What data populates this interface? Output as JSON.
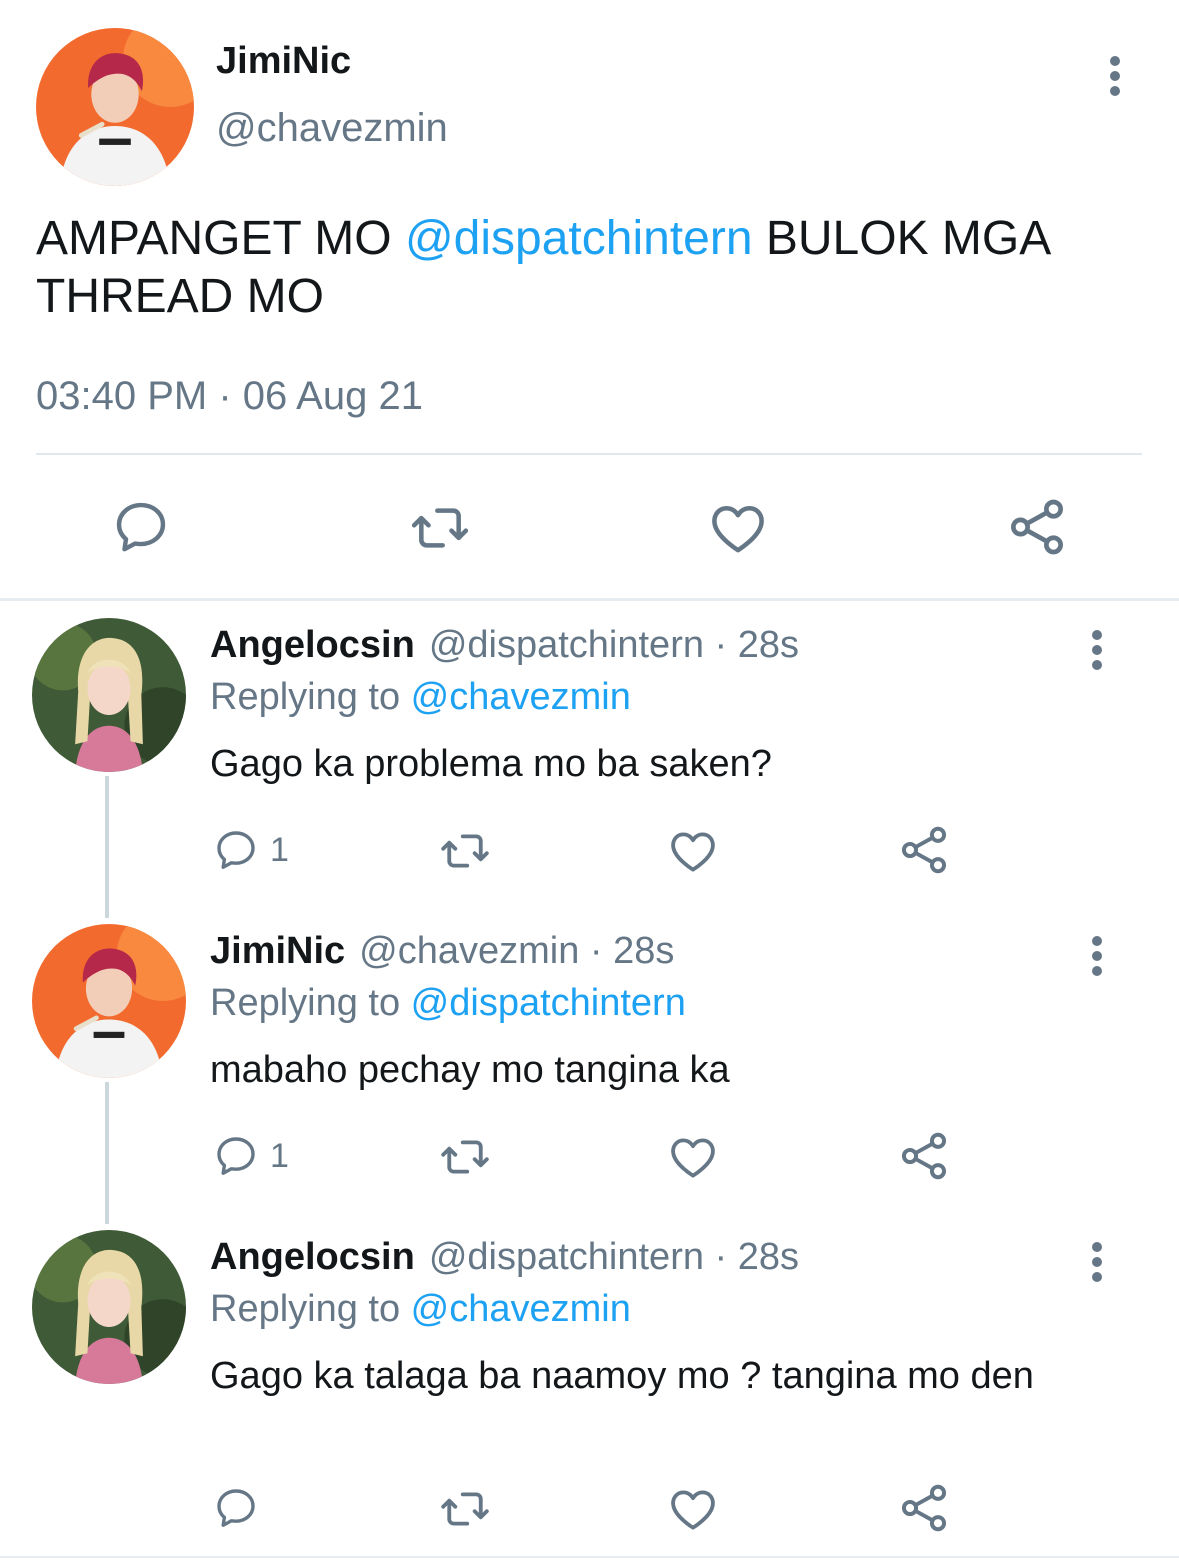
{
  "main_tweet": {
    "author_name": "JimiNic",
    "author_handle": "@chavezmin",
    "text_before": "AMPANGET MO ",
    "mention": "@dispatchintern",
    "text_after": " BULOK MGA THREAD MO",
    "timestamp": "03:40 PM · 06 Aug 21",
    "actions": [
      "reply-icon",
      "retweet-icon",
      "like-icon",
      "share-icon"
    ]
  },
  "replies": [
    {
      "author_name": "Angelocsin",
      "meta": "@dispatchintern · 28s",
      "replying_label": "Replying to ",
      "replying_to": "@chavezmin",
      "text": "Gago ka problema mo ba saken?",
      "reply_count": "1"
    },
    {
      "author_name": "JimiNic",
      "meta": "@chavezmin · 28s",
      "replying_label": "Replying to ",
      "replying_to": "@dispatchintern",
      "text": "mabaho pechay mo tangina ka",
      "reply_count": "1"
    },
    {
      "author_name": "Angelocsin",
      "meta": "@dispatchintern · 28s",
      "replying_label": "Replying to ",
      "replying_to": "@chavezmin",
      "text": "Gago ka talaga ba naamoy mo ? tangina mo den",
      "reply_count": ""
    }
  ],
  "colors": {
    "link": "#1da1f2",
    "secondary_text": "#657786",
    "icon": "#657786",
    "divider": "#e1e8ed",
    "avatar_orange": "#f26a2e"
  }
}
